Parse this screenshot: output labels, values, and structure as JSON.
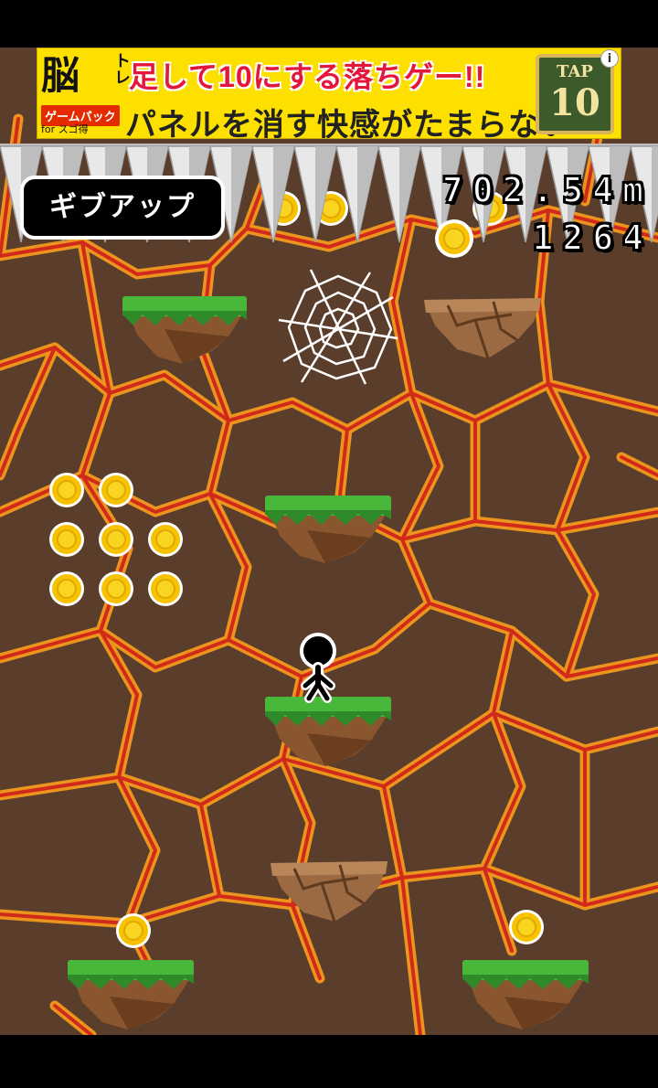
{
  "ad": {
    "brain": "脳",
    "tore": "トレ",
    "badge": "ゲームパック",
    "badge_sub": "for スゴ得",
    "title": "足して10にする落ちゲー!!",
    "subtitle": "パネルを消す快感がたまらない",
    "tap_top": "TAP",
    "tap_num": "10",
    "info": "i"
  },
  "hud": {
    "give_up_label": "ギブアップ",
    "distance": "702.54m",
    "coins": "1264"
  },
  "colors": {
    "rock": "#5a3c2a",
    "lava_line": "#d8281a",
    "lava_glow": "#f5a623",
    "grass": "#3aa335",
    "dirt": "#7a4a28",
    "coin": "#f7c300"
  },
  "sprites": {
    "player": "stickman",
    "web": "spiderweb",
    "spikes": "ceiling-spikes"
  }
}
